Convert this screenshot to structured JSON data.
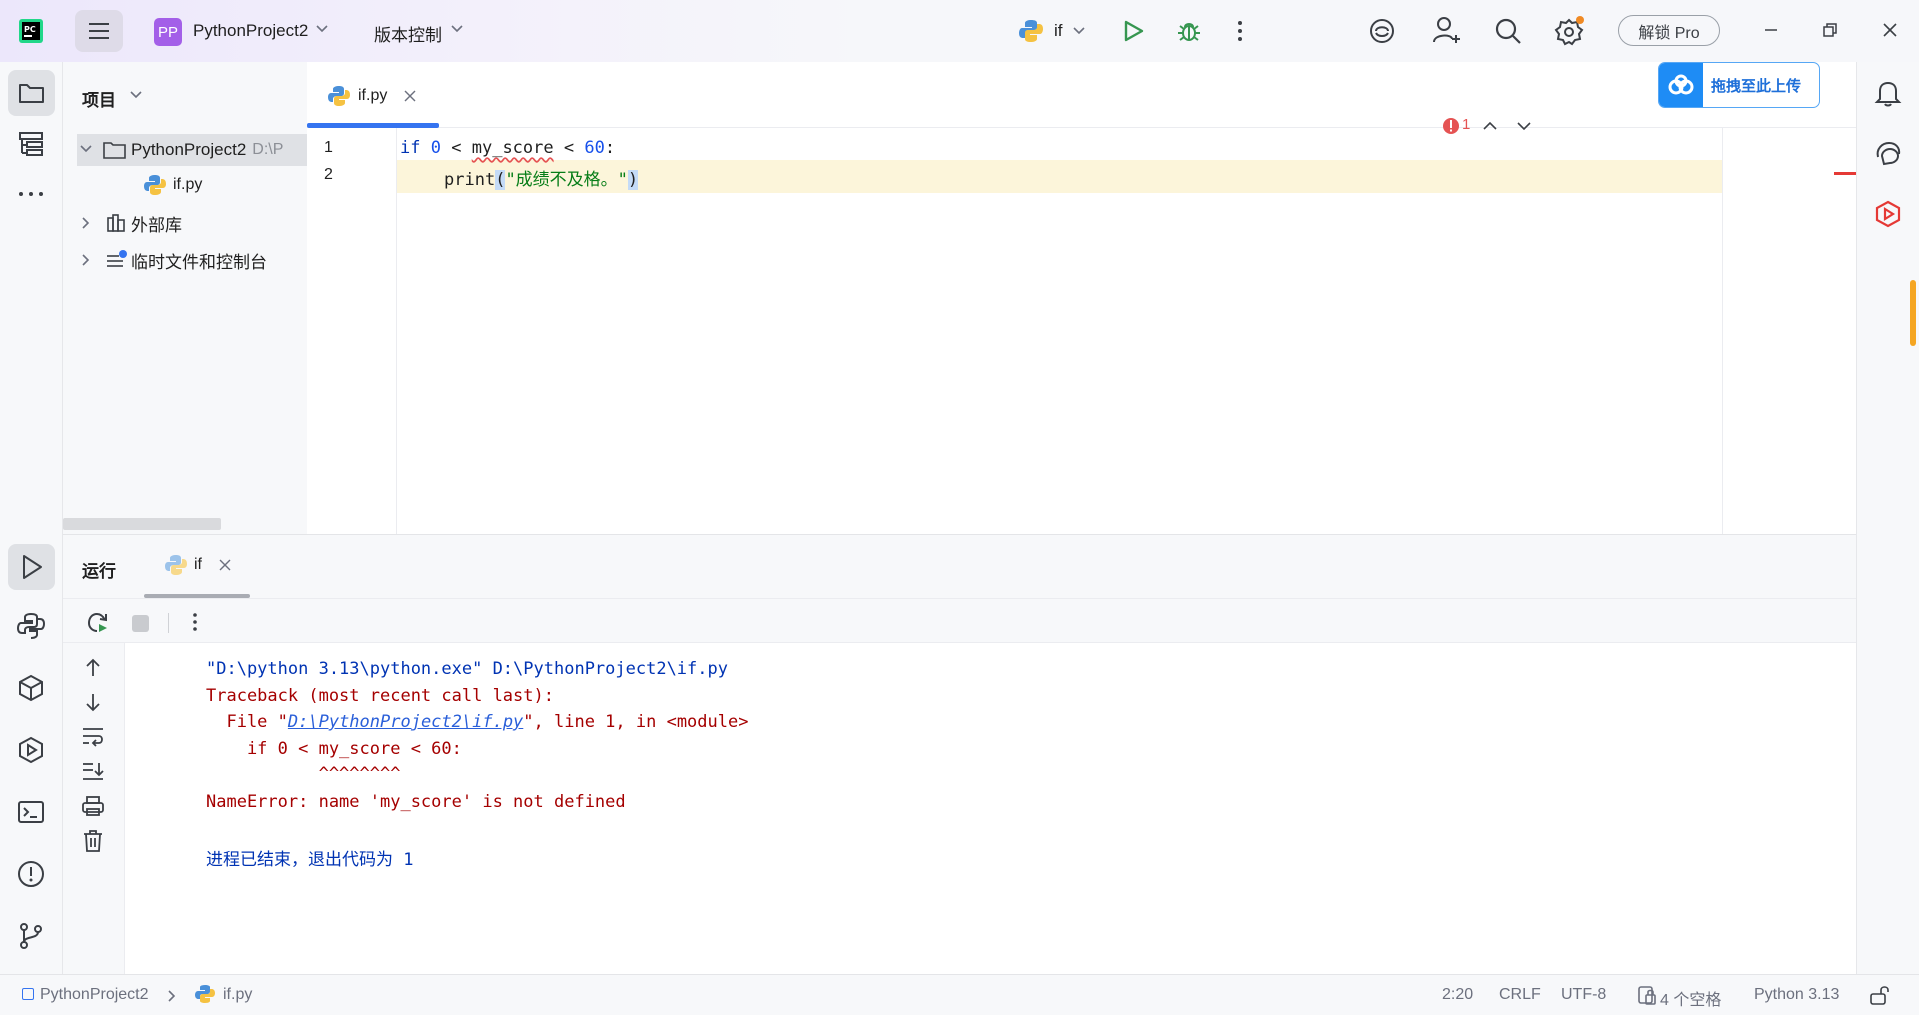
{
  "titlebar": {
    "project_badge": "PP",
    "project_name": "PythonProject2",
    "vcs_label": "版本控制",
    "run_config": "if",
    "unlock_pro": "解锁 Pro"
  },
  "upload_button": {
    "label": "拖拽至此上传"
  },
  "project_panel": {
    "header": "项目",
    "root_name": "PythonProject2",
    "root_path": "D:\\P",
    "file_name": "if.py",
    "external_libs": "外部库",
    "scratches": "临时文件和控制台"
  },
  "editor": {
    "tab_label": "if.py",
    "error_count": "1",
    "line_numbers": [
      "1",
      "2"
    ],
    "line1": {
      "kw": "if",
      "num0": "0",
      "lt1": "<",
      "var": "my_score",
      "lt2": "<",
      "num60": "60",
      "colon": ":"
    },
    "line2": {
      "func": "print",
      "lparen": "(",
      "str": "\"成绩不及格。\"",
      "rparen": ")"
    }
  },
  "run_panel": {
    "title": "运行",
    "tab_label": "if",
    "output": {
      "cmd": "\"D:\\python 3.13\\python.exe\" D:\\PythonProject2\\if.py",
      "traceback": "Traceback (most recent call last):",
      "file_prefix": "  File \"",
      "file_link": "D:\\PythonProject2\\if.py",
      "file_suffix": "\", line 1, in <module>",
      "code_line": "    if 0 < my_score < 60:",
      "carets": "           ^^^^^^^^",
      "error": "NameError: name 'my_score' is not defined",
      "exit": "进程已结束，退出代码为 1"
    }
  },
  "status_bar": {
    "crumb_project": "PythonProject2",
    "crumb_file": "if.py",
    "position": "2:20",
    "line_sep": "CRLF",
    "encoding": "UTF-8",
    "indent": "4 个空格",
    "interpreter": "Python 3.13"
  },
  "colors": {
    "keyword": "#0033b3",
    "number": "#1750eb",
    "string": "#067d17",
    "error_text": "#a50000",
    "highlight_line": "#fcf5da",
    "accent": "#3574f0",
    "run_green": "#369650"
  }
}
